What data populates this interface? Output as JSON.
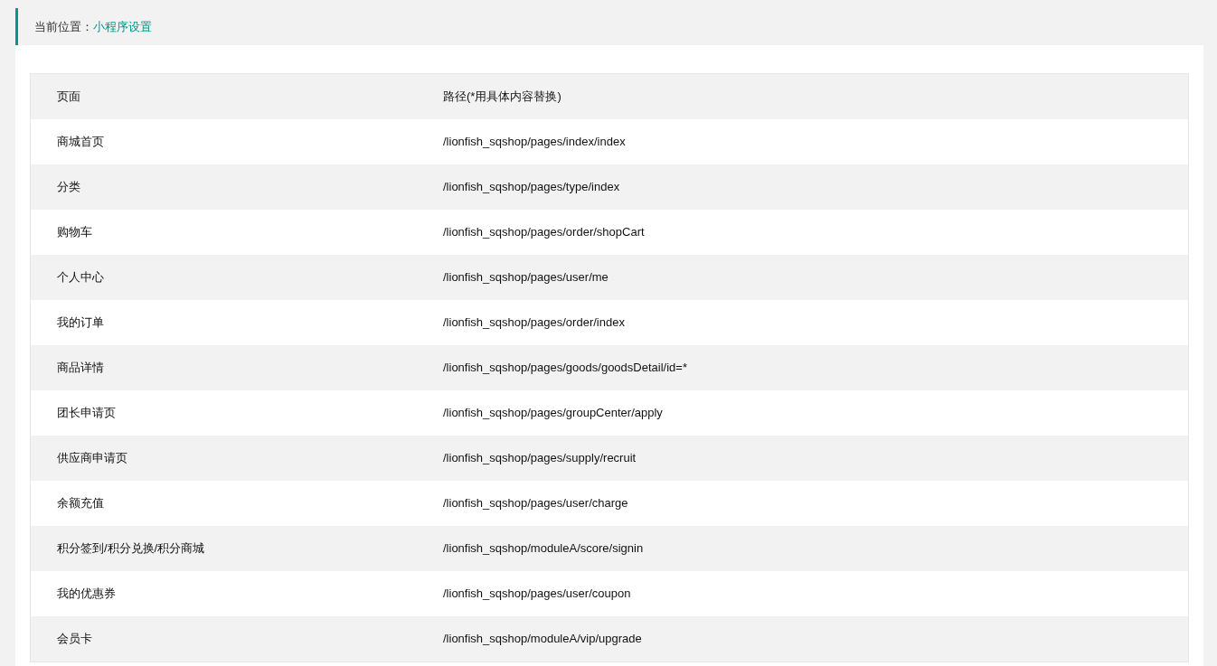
{
  "breadcrumb": {
    "label": "当前位置：",
    "current": "小程序设置"
  },
  "table": {
    "columns": [
      "页面",
      "路径(*用具体内容替换)"
    ],
    "rows": [
      [
        "商城首页",
        "/lionfish_sqshop/pages/index/index"
      ],
      [
        "分类",
        "/lionfish_sqshop/pages/type/index"
      ],
      [
        "购物车",
        "/lionfish_sqshop/pages/order/shopCart"
      ],
      [
        "个人中心",
        "/lionfish_sqshop/pages/user/me"
      ],
      [
        "我的订单",
        "/lionfish_sqshop/pages/order/index"
      ],
      [
        "商品详情",
        "/lionfish_sqshop/pages/goods/goodsDetail/id=*"
      ],
      [
        "团长申请页",
        "/lionfish_sqshop/pages/groupCenter/apply"
      ],
      [
        "供应商申请页",
        "/lionfish_sqshop/pages/supply/recruit"
      ],
      [
        "余额充值",
        "/lionfish_sqshop/pages/user/charge"
      ],
      [
        "积分签到/积分兑换/积分商城",
        "/lionfish_sqshop/moduleA/score/signin"
      ],
      [
        "我的优惠券",
        "/lionfish_sqshop/pages/user/coupon"
      ],
      [
        "会员卡",
        "/lionfish_sqshop/moduleA/vip/upgrade"
      ]
    ]
  }
}
